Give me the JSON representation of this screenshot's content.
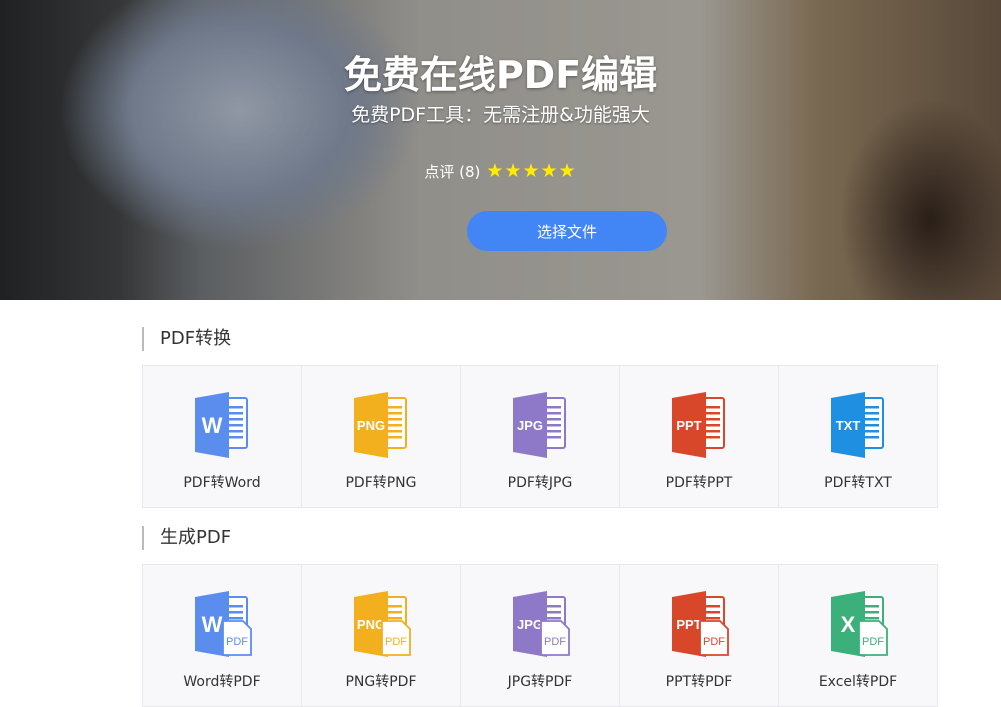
{
  "hero": {
    "title": "免费在线PDF编辑",
    "subtitle": "免费PDF工具：无需注册&功能强大",
    "rating_label": "点评 (8)",
    "stars": "★★★★★",
    "rating_stars": 5,
    "button": "选择文件"
  },
  "sections": [
    {
      "title": "PDF转换",
      "items": [
        {
          "label": "PDF转Word",
          "icon": "word-icon",
          "icon_text": "W",
          "color": "#5b8def"
        },
        {
          "label": "PDF转PNG",
          "icon": "png-icon",
          "icon_text": "PNG",
          "color": "#f2b01e"
        },
        {
          "label": "PDF转JPG",
          "icon": "jpg-icon",
          "icon_text": "JPG",
          "color": "#8e79c9"
        },
        {
          "label": "PDF转PPT",
          "icon": "ppt-icon",
          "icon_text": "PPT",
          "color": "#d9472b"
        },
        {
          "label": "PDF转TXT",
          "icon": "txt-icon",
          "icon_text": "TXT",
          "color": "#1e8fe1"
        }
      ]
    },
    {
      "title": "生成PDF",
      "items": [
        {
          "label": "Word转PDF",
          "icon": "word-to-pdf-icon",
          "icon_text": "W",
          "color": "#5b8def"
        },
        {
          "label": "PNG转PDF",
          "icon": "png-to-pdf-icon",
          "icon_text": "PNG",
          "color": "#f2b01e"
        },
        {
          "label": "JPG转PDF",
          "icon": "jpg-to-pdf-icon",
          "icon_text": "JPG",
          "color": "#8e79c9"
        },
        {
          "label": "PPT转PDF",
          "icon": "ppt-to-pdf-icon",
          "icon_text": "PPT",
          "color": "#d9472b"
        },
        {
          "label": "Excel转PDF",
          "icon": "excel-to-pdf-icon",
          "icon_text": "X",
          "color": "#3bb07a"
        }
      ]
    }
  ],
  "pdf_badge": "PDF"
}
